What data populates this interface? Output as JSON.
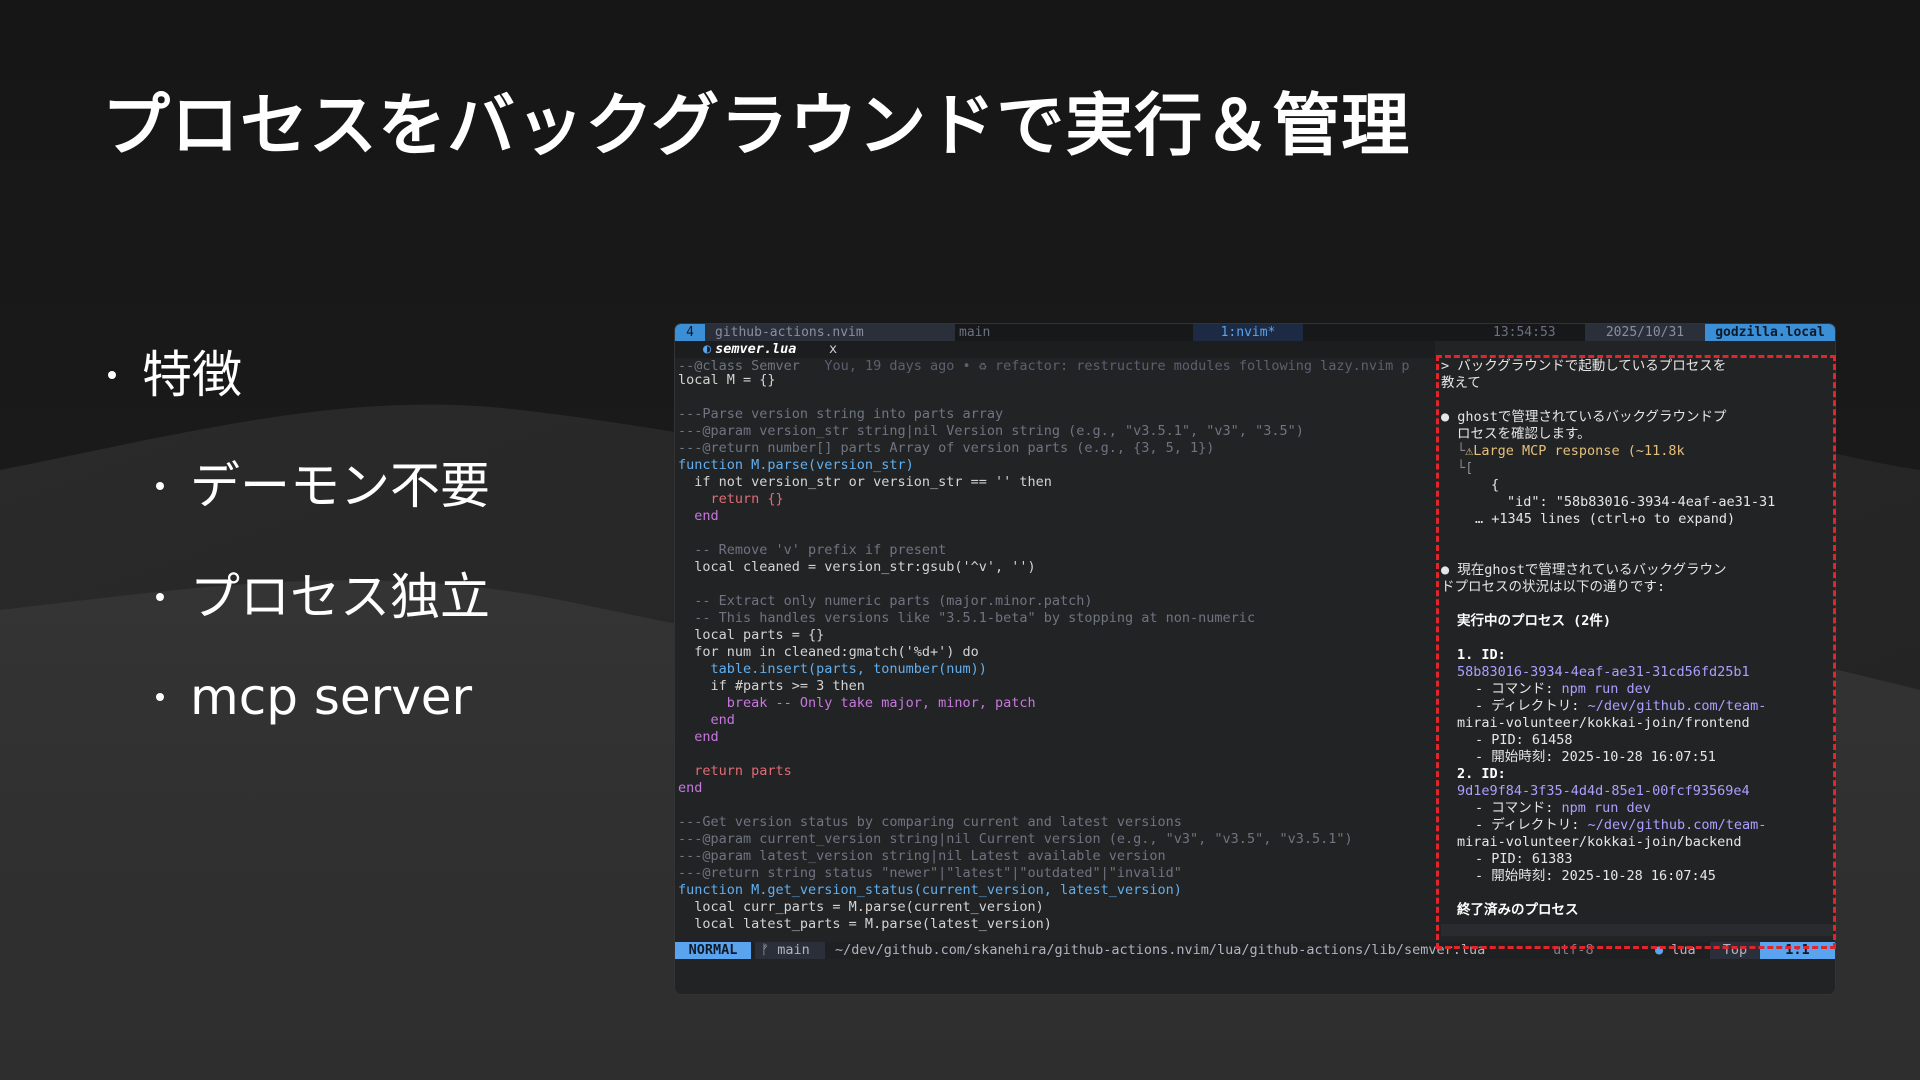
{
  "slide": {
    "title": "プロセスをバックグラウンドで実行＆管理",
    "bullets": [
      "特徴",
      "デーモン不要",
      "プロセス独立",
      "mcp server"
    ]
  },
  "tmux": {
    "window_number": "4",
    "repo": "github-actions.nvim",
    "branch": "main",
    "window_name": "1:nvim*",
    "time": "13:54:53",
    "date": "2025/10/31",
    "host": "godzilla.local"
  },
  "editor": {
    "tab_name": "semver.lua",
    "tab_close": "x",
    "code_lines": [
      "--@class Semver",
      "local M = {}",
      "",
      "---Parse version string into parts array",
      "---@param version_str string|nil Version string (e.g., \"v3.5.1\", \"v3\", \"3.5\")",
      "---@return number[] parts Array of version parts (e.g., {3, 5, 1})",
      "function M.parse(version_str)",
      "  if not version_str or version_str == '' then",
      "    return {}",
      "  end",
      "",
      "  -- Remove 'v' prefix if present",
      "  local cleaned = version_str:gsub('^v', '')",
      "",
      "  -- Extract only numeric parts (major.minor.patch)",
      "  -- This handles versions like \"3.5.1-beta\" by stopping at non-numeric",
      "  local parts = {}",
      "  for num in cleaned:gmatch('%d+') do",
      "    table.insert(parts, tonumber(num))",
      "    if #parts >= 3 then",
      "      break -- Only take major, minor, patch",
      "    end",
      "  end",
      "",
      "  return parts",
      "end",
      "",
      "---Get version status by comparing current and latest versions",
      "---@param current_version string|nil Current version (e.g., \"v3\", \"v3.5\", \"v3.5.1\")",
      "---@param latest_version string|nil Latest available version",
      "---@return string status \"newer\"|\"latest\"|\"outdated\"|\"invalid\"",
      "function M.get_version_status(current_version, latest_version)",
      "  local curr_parts = M.parse(current_version)",
      "  local latest_parts = M.parse(latest_version)"
    ],
    "blame": "You, 19 days ago • ♻ refactor: restructure modules following lazy.nvim p"
  },
  "statusline": {
    "mode": "NORMAL",
    "branch": "main",
    "path": "~/dev/github.com/skanehira/github-actions.nvim/lua/github-actions/lib/semver.lua",
    "encoding": "utf-8",
    "filetype": "lua",
    "scroll": "Top",
    "position": "1:1"
  },
  "claude": {
    "prompt_1": "> バックグラウンドで起動しているプロセスを",
    "prompt_2": "教えて",
    "msg1_1": "● ghostで管理されているバックグラウンドプ",
    "msg1_2": "ロセスを確認します。",
    "warn": "⚠Large MCP response (~11.8k",
    "tree_1": "└",
    "tree_2": "└[",
    "json_open": "{",
    "json_id": "\"id\": \"58b83016-3934-4eaf-ae31-31",
    "more_lines": "… +1345 lines (ctrl+o to expand)",
    "msg2_1": "● 現在ghostで管理されているバックグラウン",
    "msg2_2": "ドプロセスの状況は以下の通りです:",
    "running_heading": "実行中のプロセス (2件)",
    "p1_label": "1. ID:",
    "p1_id": "58b83016-3934-4eaf-ae31-31cd56fd25b1",
    "p1_cmd_label": "- コマンド: ",
    "p1_cmd": "npm run dev",
    "p1_dir_label": "- ディレクトリ: ",
    "p1_dir_1": "~/dev/github.com/team-",
    "p1_dir_2": "mirai-volunteer/kokkai-join/frontend",
    "p1_pid": "- PID: 61458",
    "p1_start": "- 開始時刻: 2025-10-28 16:07:51",
    "p2_label": "2. ID:",
    "p2_id": "9d1e9f84-3f35-4d4d-85e1-00fcf93569e4",
    "p2_cmd_label": "- コマンド: ",
    "p2_cmd": "npm run dev",
    "p2_dir_label": "- ディレクトリ: ",
    "p2_dir_1": "~/dev/github.com/team-",
    "p2_dir_2": "mirai-volunteer/kokkai-join/backend",
    "p2_pid": "- PID: 61383",
    "p2_start": "- 開始時刻: 2025-10-28 16:07:45",
    "finished_heading": "終了済みのプロセス"
  },
  "colors": {
    "background": "#1b1b1b",
    "accent_blue": "#3b8fd6",
    "highlight_red": "#e0262b"
  }
}
